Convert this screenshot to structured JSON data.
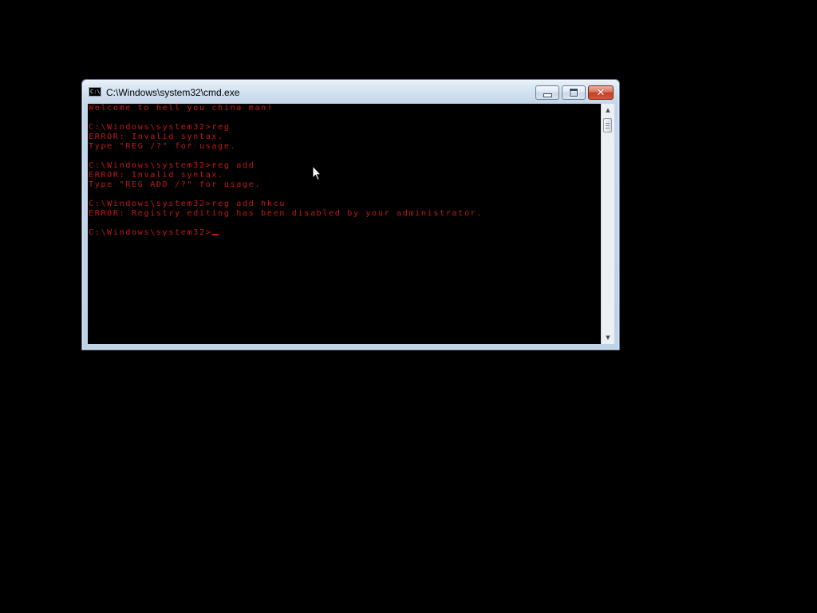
{
  "window": {
    "title": "C:\\Windows\\system32\\cmd.exe",
    "icon_text": "C:\\",
    "buttons": {
      "minimize_icon": "minimize-icon",
      "maximize_icon": "maximize-icon",
      "close_glyph": "✕"
    }
  },
  "console": {
    "text_color": "#c41818",
    "background": "#000000",
    "lines": [
      "Welcome to hell you china man!",
      "",
      "C:\\Windows\\system32>reg",
      "ERROR: Invalid syntax.",
      "Type \"REG /?\" for usage.",
      "",
      "C:\\Windows\\system32>reg add",
      "ERROR: Invalid syntax.",
      "Type \"REG ADD /?\" for usage.",
      "",
      "C:\\Windows\\system32>reg add hkcu",
      "ERROR: Registry editing has been disabled by your administrator.",
      "",
      "C:\\Windows\\system32>"
    ]
  },
  "scrollbar": {
    "up_arrow": "▲",
    "down_arrow": "▼"
  }
}
